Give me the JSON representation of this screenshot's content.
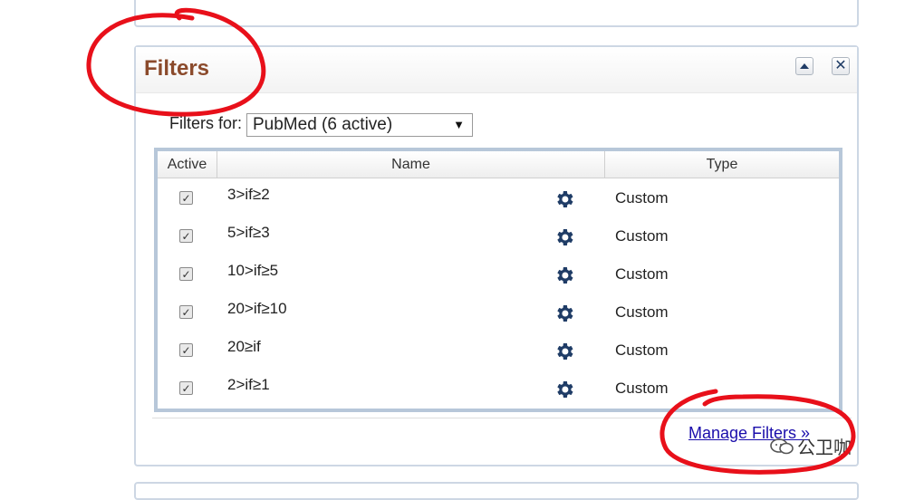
{
  "panel": {
    "title": "Filters",
    "filters_for_label": "Filters for:",
    "selected_db": "PubMed (6 active)",
    "select_arrow": "▼"
  },
  "table": {
    "headers": {
      "active": "Active",
      "name": "Name",
      "type": "Type"
    },
    "rows": [
      {
        "name": "3>if≥2",
        "type": "Custom",
        "checked": true
      },
      {
        "name": "5>if≥3",
        "type": "Custom",
        "checked": true
      },
      {
        "name": "10>if≥5",
        "type": "Custom",
        "checked": true
      },
      {
        "name": "20>if≥10",
        "type": "Custom",
        "checked": true
      },
      {
        "name": "20≥if",
        "type": "Custom",
        "checked": true
      },
      {
        "name": "2>if≥1",
        "type": "Custom",
        "checked": true
      }
    ]
  },
  "links": {
    "manage_filters": "Manage Filters »"
  },
  "watermark": {
    "text": "公卫咖"
  },
  "colors": {
    "title": "#8b4a2b",
    "link": "#1a0dab",
    "gear": "#1f3c66",
    "annotation": "#e8101a",
    "table_border": "#b7c7d9"
  },
  "icons": {
    "collapse": "triangle-up-icon",
    "close": "close-icon",
    "settings": "gear-icon",
    "checkbox": "checkmark-icon"
  }
}
